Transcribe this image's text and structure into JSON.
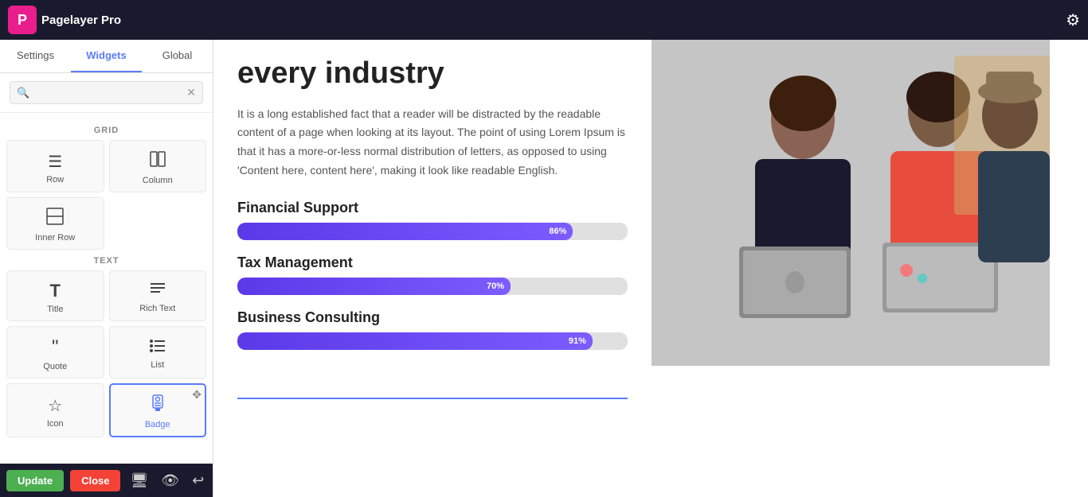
{
  "topbar": {
    "logo_letter": "P",
    "logo_text": "Pagelayer Pro",
    "gear_icon": "⚙"
  },
  "tabs": [
    {
      "id": "settings",
      "label": "Settings"
    },
    {
      "id": "widgets",
      "label": "Widgets",
      "active": true
    },
    {
      "id": "global",
      "label": "Global"
    }
  ],
  "search": {
    "placeholder": "",
    "clear_icon": "✕"
  },
  "sections": [
    {
      "label": "GRID",
      "widgets": [
        {
          "id": "row",
          "icon": "☰",
          "label": "Row"
        },
        {
          "id": "column",
          "icon": "⬜",
          "label": "Column"
        },
        {
          "id": "inner-row",
          "icon": "⊞",
          "label": "Inner Row"
        }
      ]
    },
    {
      "label": "TEXT",
      "widgets": [
        {
          "id": "title",
          "icon": "T",
          "label": "Title"
        },
        {
          "id": "rich-text",
          "icon": "≡",
          "label": "Rich Text"
        },
        {
          "id": "quote",
          "icon": "❝",
          "label": "Quote"
        },
        {
          "id": "list",
          "icon": "☰",
          "label": "List"
        },
        {
          "id": "icon",
          "icon": "☆",
          "label": "Icon"
        },
        {
          "id": "badge",
          "icon": "🪪",
          "label": "Badge",
          "active": true
        }
      ]
    }
  ],
  "bottom_toolbar": {
    "update_label": "Update",
    "close_label": "Close"
  },
  "content": {
    "headline": "every industry",
    "body_text": "It is a long established fact that a reader will be distracted by the readable content of a page when looking at its layout. The point of using Lorem Ipsum is that it has a more-or-less normal distribution of letters, as opposed to using 'Content here, content here', making it look like readable English.",
    "skills": [
      {
        "label": "Financial Support",
        "pct": 86,
        "pct_label": "86%"
      },
      {
        "label": "Tax Management",
        "pct": 70,
        "pct_label": "70%"
      },
      {
        "label": "Business Consulting",
        "pct": 91,
        "pct_label": "91%"
      }
    ]
  },
  "drag_handle_icon": "✥"
}
